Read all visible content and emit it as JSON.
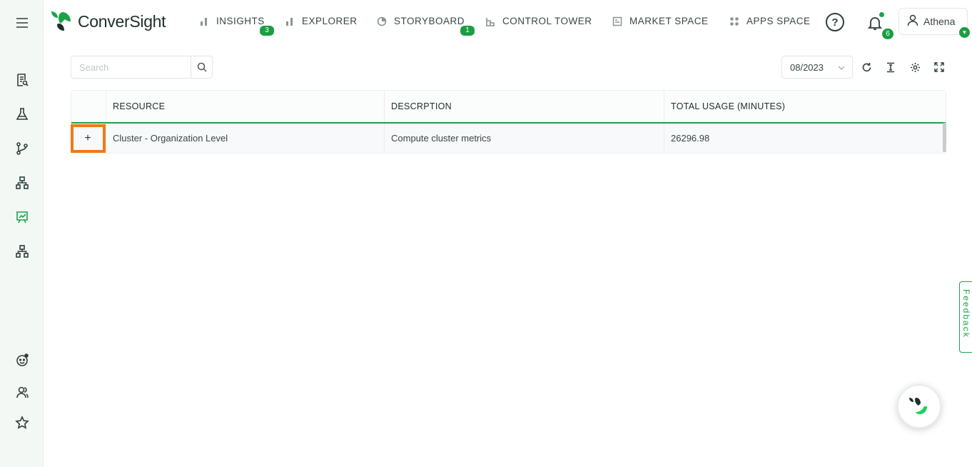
{
  "app": {
    "logo_text": "ConverSight"
  },
  "nav": {
    "items": [
      {
        "label": "INSIGHTS",
        "badge": "3"
      },
      {
        "label": "EXPLORER"
      },
      {
        "label": "STORYBOARD",
        "badge": "1"
      },
      {
        "label": "CONTROL TOWER"
      },
      {
        "label": "MARKET SPACE"
      },
      {
        "label": "APPS SPACE"
      }
    ]
  },
  "header": {
    "help_label": "?",
    "notifications_count": "6",
    "user_name": "Athena"
  },
  "toolbar": {
    "search_placeholder": "Search",
    "date_value": "08/2023"
  },
  "table": {
    "columns": [
      "RESOURCE",
      "DESCRPTION",
      "TOTAL USAGE (MINUTES)"
    ],
    "rows": [
      {
        "expand": "+",
        "resource": "Cluster - Organization Level",
        "description": "Compute cluster metrics",
        "total_usage": "26296.98"
      }
    ]
  },
  "feedback_label": "Feedback",
  "colors": {
    "accent": "#1aa34a",
    "highlight": "#f07a1a"
  }
}
